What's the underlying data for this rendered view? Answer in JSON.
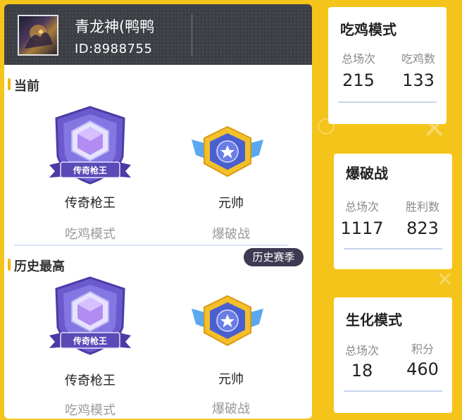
{
  "profile": {
    "name": "青龙神(鸭鸭",
    "id_text": "ID:8988755"
  },
  "current": {
    "title": "当前",
    "ranks": [
      {
        "rank": "传奇枪王",
        "mode": "吃鸡模式",
        "badge_text": "传奇枪王",
        "icon": "legend-gunking-badge-icon"
      },
      {
        "rank": "元帅",
        "mode": "爆破战",
        "icon": "marshal-star-badge-icon"
      }
    ]
  },
  "history": {
    "title": "历史最高",
    "season_button": "历史赛季",
    "ranks": [
      {
        "rank": "传奇枪王",
        "mode": "吃鸡模式",
        "badge_text": "传奇枪王",
        "icon": "legend-gunking-badge-icon"
      },
      {
        "rank": "元帅",
        "mode": "爆破战",
        "icon": "marshal-star-badge-icon"
      }
    ]
  },
  "stats": [
    {
      "title": "吃鸡模式",
      "left_label": "总场次",
      "left_value": "215",
      "right_label": "吃鸡数",
      "right_value": "133"
    },
    {
      "title": "爆破战",
      "left_label": "总场次",
      "left_value": "1117",
      "right_label": "胜利数",
      "right_value": "823"
    },
    {
      "title": "生化模式",
      "left_label": "总场次",
      "left_value": "18",
      "right_label": "积分",
      "right_value": "460"
    }
  ],
  "colors": {
    "background": "#f5c41b",
    "header": "#3b3e44",
    "accent": "#f5b700",
    "badge_purple": "#5b4bb7",
    "badge_gold": "#f3c02c"
  }
}
